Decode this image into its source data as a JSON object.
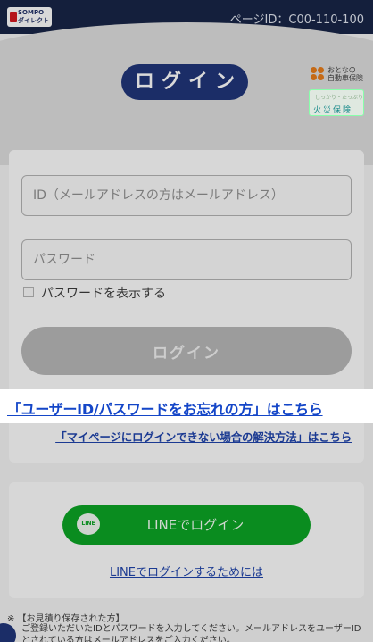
{
  "header": {
    "logo_line1": "SOMPO",
    "logo_line2": "ダイレクト",
    "page_id": "ページID：C00-110-100"
  },
  "title": "ログイン",
  "ads": {
    "otona_line1": "おとなの",
    "otona_line2": "自動車保険",
    "fire_label": "火災保険",
    "fire_small": "しっかり・たっぷり"
  },
  "form": {
    "id_placeholder": "ID（メールアドレスの方はメールアドレス）",
    "password_placeholder": "パスワード",
    "show_password_label": "パスワードを表示する",
    "login_button": "ログイン"
  },
  "links": {
    "forgot": "「ユーザーID/パスワードをお忘れの方」はこちら",
    "trouble": "「マイページにログインできない場合の解決方法」はこちら"
  },
  "line": {
    "icon_text": "LINE",
    "button": "LINEでログイン",
    "help_link": "LINEでログインするためには"
  },
  "notes": {
    "head": "※ 【お見積り保存された方】",
    "body": "ご登録いただいたIDとパスワードを入力してください。メールアドレスをユーザーIDとされている方はメールアドレスをご入力ください。"
  }
}
